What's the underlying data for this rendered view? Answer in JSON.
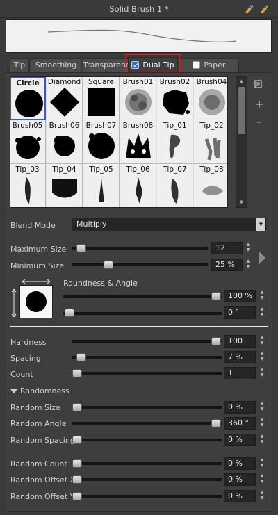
{
  "window": {
    "title": "Solid Brush 1 *"
  },
  "tabs": [
    {
      "label": "Tip"
    },
    {
      "label": "Smoothing"
    },
    {
      "label": "Transparency"
    },
    {
      "label": "Dual Tip",
      "checked": true
    },
    {
      "label": "Paper Texture",
      "checked": false
    }
  ],
  "tips": [
    "Circle",
    "Diamond",
    "Square",
    "Brush01",
    "Brush02",
    "Brush04",
    "Brush05",
    "Brush06",
    "Brush07",
    "Brush08",
    "Tip_01",
    "Tip_02",
    "Tip_03",
    "Tip_04",
    "Tip_05",
    "Tip_06",
    "Tip_07",
    "Tip_08"
  ],
  "selected_tip": "Circle",
  "blend_mode": {
    "label": "Blend Mode",
    "value": "Multiply"
  },
  "max_size": {
    "label": "Maximum Size",
    "value": "12"
  },
  "min_size": {
    "label": "Minimum Size",
    "value": "25 %"
  },
  "roundness": {
    "label": "Roundness & Angle",
    "roundness_value": "100 %",
    "angle_value": "0 °"
  },
  "hardness": {
    "label": "Hardness",
    "value": "100"
  },
  "spacing": {
    "label": "Spacing",
    "value": "7 %"
  },
  "count": {
    "label": "Count",
    "value": "1"
  },
  "randomness": {
    "label": "Randomness",
    "random_size": {
      "label": "Random Size",
      "value": "0 %"
    },
    "random_angle": {
      "label": "Random Angle",
      "value": "360 °"
    },
    "random_spacing": {
      "label": "Random Spacing",
      "value": "0 %"
    },
    "random_count": {
      "label": "Random Count",
      "value": "0 %"
    },
    "random_offset_x": {
      "label": "Random Offset X",
      "value": "0 %"
    },
    "random_offset_y": {
      "label": "Random Offset Y",
      "value": "0 %"
    }
  },
  "colors": {
    "accent": "#2f6fd1",
    "highlight": "#d91c1c",
    "selection": "#3a56c8"
  },
  "icons": [
    "brush-add-icon",
    "brush-remove-icon",
    "menu-icon",
    "plus-icon",
    "minus-icon",
    "expand-arrow-icon"
  ]
}
